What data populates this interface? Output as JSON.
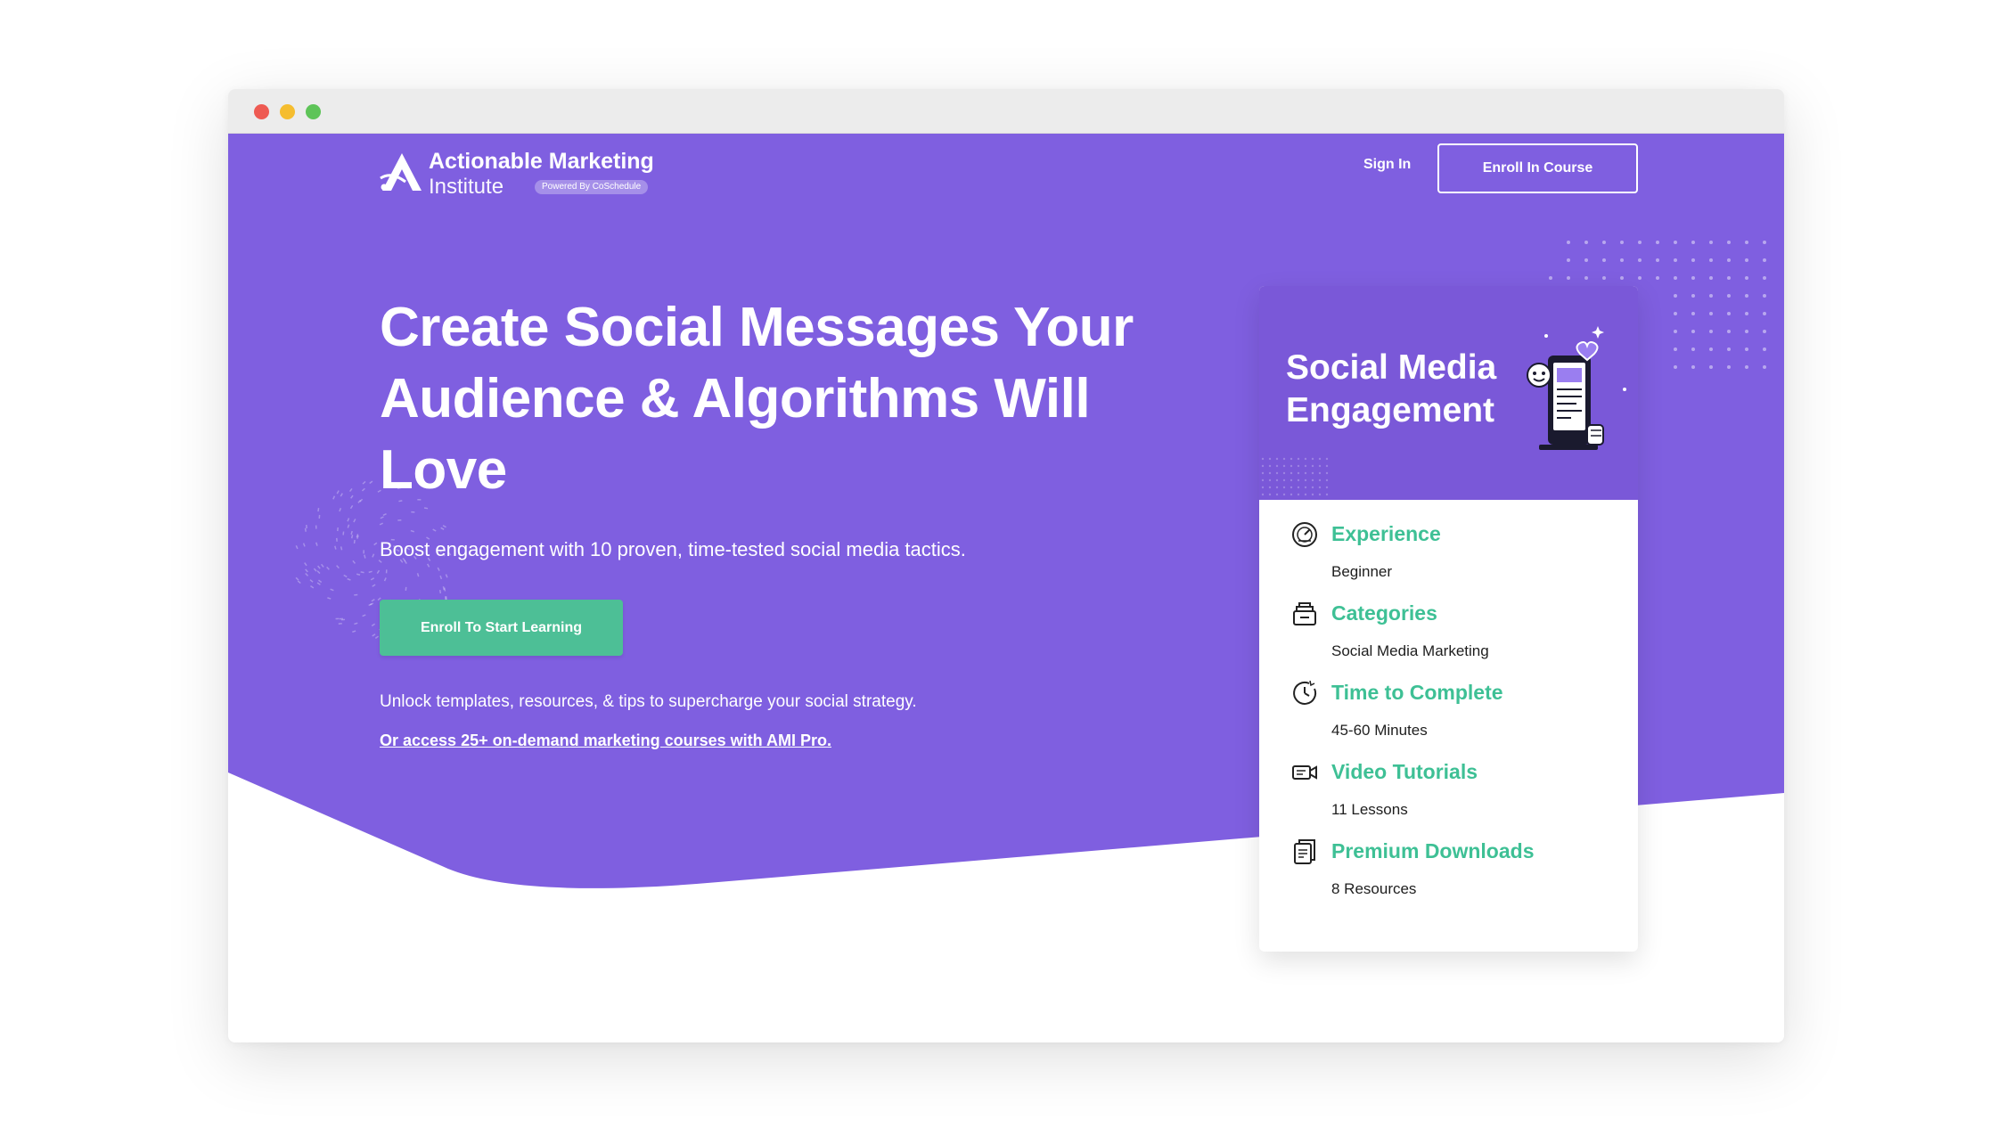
{
  "colors": {
    "hero_purple": "#7f5fe0",
    "card_header_purple": "#7a58d8",
    "accent_green": "#4dbf96",
    "detail_title_green": "#3ec095",
    "window_red": "#ee5a52",
    "window_yellow": "#f5bd2f",
    "window_green": "#5ec458"
  },
  "window": {
    "controls": [
      "close",
      "minimize",
      "maximize"
    ]
  },
  "brand": {
    "name_line1": "Actionable Marketing",
    "name_line2": "Institute",
    "badge": "Powered By CoSchedule",
    "icon": "ami-logo-icon"
  },
  "nav": {
    "sign_in": "Sign In",
    "enroll_course": "Enroll In Course"
  },
  "hero": {
    "headline": "Create Social Messages Your Audience & Algorithms Will Love",
    "subhead": "Boost engagement with 10 proven, time-tested social media tactics.",
    "cta": "Enroll To Start Learning",
    "unlock_text": "Unlock templates, resources, & tips to supercharge your social strategy.",
    "pro_link": "Or access 25+ on-demand marketing courses with AMI Pro."
  },
  "course_card": {
    "title": "Social Media Engagement",
    "illustration": "phone-with-emoji-illustration",
    "details": [
      {
        "icon": "gauge-icon",
        "title": "Experience",
        "value": "Beginner"
      },
      {
        "icon": "stacked-folders-icon",
        "title": "Categories",
        "value": "Social Media Marketing"
      },
      {
        "icon": "clock-icon",
        "title": "Time to Complete",
        "value": "45-60 Minutes"
      },
      {
        "icon": "video-camera-icon",
        "title": "Video Tutorials",
        "value": "11 Lessons"
      },
      {
        "icon": "download-document-icon",
        "title": "Premium Downloads",
        "value": "8 Resources"
      }
    ]
  }
}
